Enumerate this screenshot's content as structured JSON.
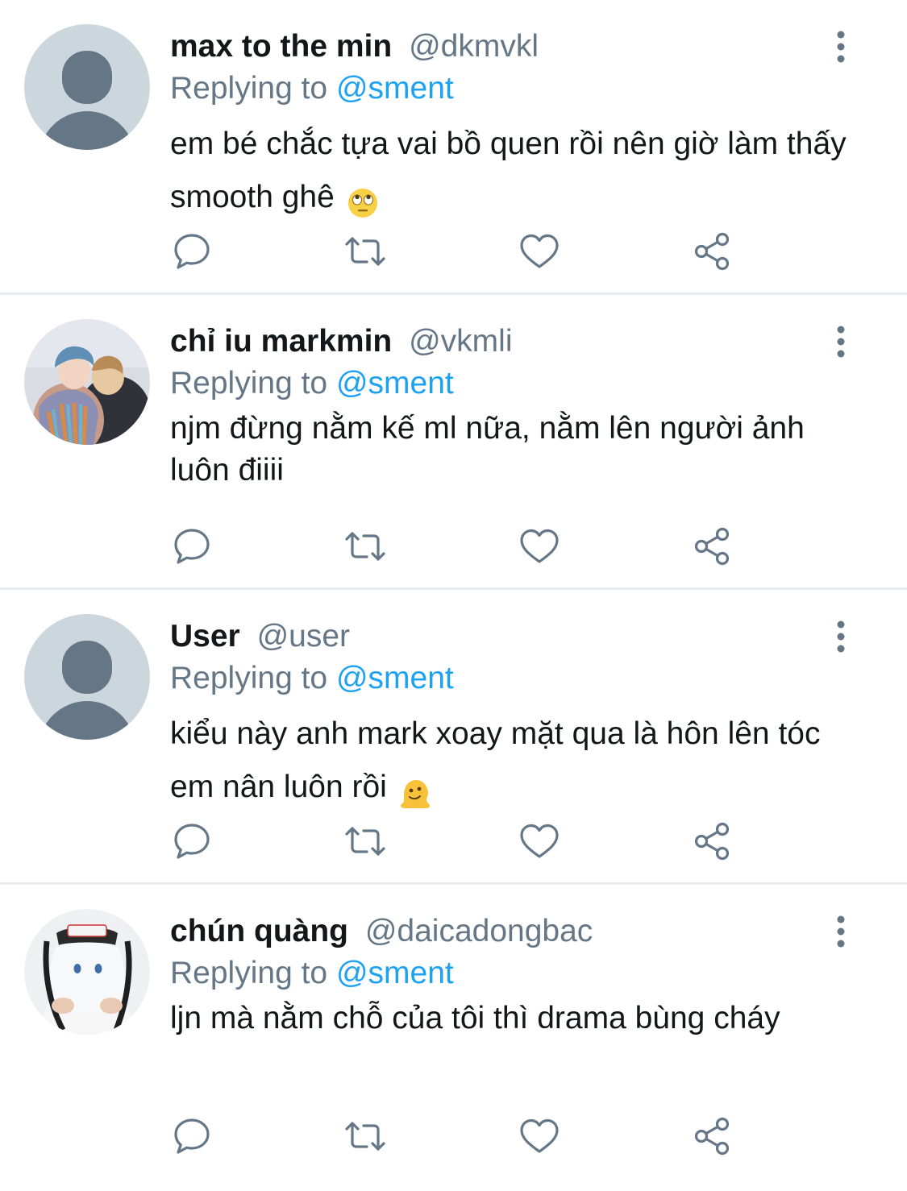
{
  "tweets": [
    {
      "display_name": "max to the min",
      "handle": "@dkmvkl",
      "replying_prefix": "Replying to",
      "replying_to": "@sment",
      "text": "em bé chắc tựa vai bồ quen rồi nên giờ làm thấy smooth ghê",
      "emoji": "eye-roll-emoji",
      "avatar": "default-avatar"
    },
    {
      "display_name": "chỉ iu markmin",
      "handle": "@vkmli",
      "replying_prefix": "Replying to",
      "replying_to": "@sment",
      "text": "njm đừng nằm kế ml nữa, nằm lên người ảnh luôn điiii",
      "avatar": "photo-avatar-two-people"
    },
    {
      "display_name": "User",
      "handle": "@user",
      "replying_prefix": "Replying to",
      "replying_to": "@sment",
      "text": "kiểu này anh mark xoay mặt qua là hôn lên tóc em nân luôn rồi",
      "emoji": "melting-face-emoji",
      "avatar": "default-avatar"
    },
    {
      "display_name": "chún quàng",
      "handle": "@daicadongbac",
      "replying_prefix": "Replying to",
      "replying_to": "@sment",
      "text": "ljn mà nằm chỗ của tôi thì drama bùng cháy",
      "avatar": "photo-avatar-plush-toy"
    }
  ],
  "colors": {
    "accent": "#1da1f2",
    "secondary_text": "#657786",
    "icon": "#657786",
    "divider": "#e6ecf0",
    "default_avatar_bg": "#ccd6dd",
    "default_avatar_fg": "#657786"
  },
  "icons": {
    "reply": "reply-icon",
    "retweet": "retweet-icon",
    "like": "heart-icon",
    "share": "share-icon",
    "more": "more-vertical-icon"
  }
}
